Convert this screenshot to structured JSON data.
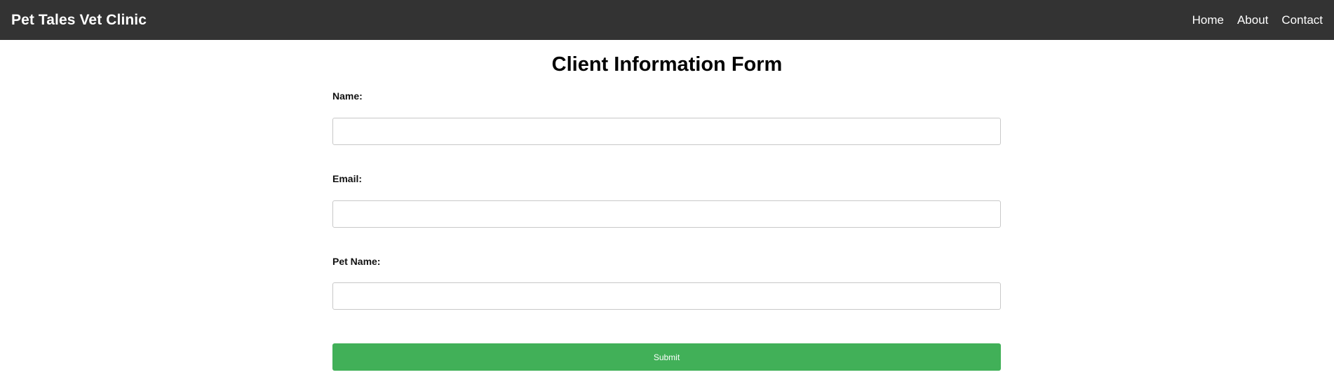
{
  "nav": {
    "brand": "Pet Tales Vet Clinic",
    "links": [
      "Home",
      "About",
      "Contact"
    ]
  },
  "page": {
    "title": "Client Information Form"
  },
  "form": {
    "fields": [
      {
        "label": "Name:",
        "value": "",
        "placeholder": ""
      },
      {
        "label": "Email:",
        "value": "",
        "placeholder": ""
      },
      {
        "label": "Pet Name:",
        "value": "",
        "placeholder": ""
      }
    ],
    "submit_label": "Submit"
  },
  "colors": {
    "navbar": "#333333",
    "submit": "#41b058"
  }
}
